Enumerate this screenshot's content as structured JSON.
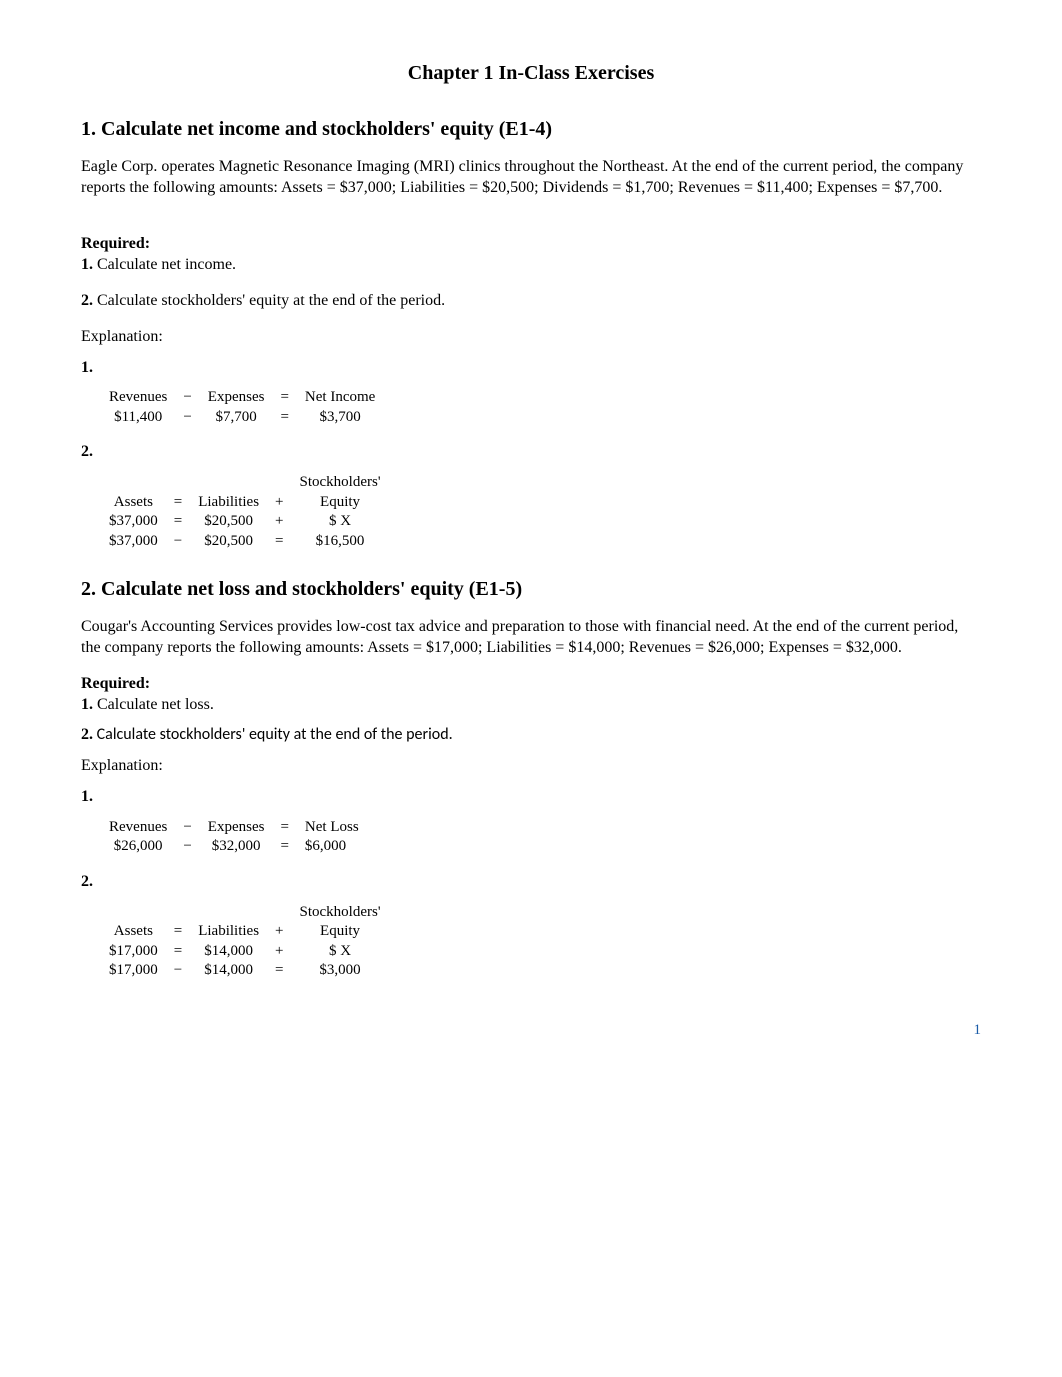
{
  "chapter_title": "Chapter 1 In-Class Exercises",
  "section1": {
    "title": "1. Calculate net income and stockholders' equity (E1-4)",
    "body": "Eagle Corp. operates Magnetic Resonance Imaging (MRI) clinics throughout the Northeast. At the end of the current period, the company reports the following amounts: Assets = $37,000; Liabilities = $20,500; Dividends = $1,700; Revenues = $11,400; Expenses = $7,700.",
    "required_label": "Required:",
    "req1_num": "1.",
    "req1_text": "  Calculate net income.",
    "req2_num": "2.",
    "req2_text": "  Calculate stockholders' equity at the end of the period.",
    "explanation_label": "Explanation:",
    "part1_num": "1.",
    "eq1": {
      "h1": "Revenues",
      "op1": "−",
      "h2": "Expenses",
      "op2": "=",
      "h3": "Net Income",
      "v1": "$11,400",
      "v2": "$7,700",
      "v3": "$3,700"
    },
    "part2_num": "2.",
    "eq2": {
      "h1": "Assets",
      "op1": "=",
      "h2": "Liabilities",
      "op2": "+",
      "h3a": "Stockholders'",
      "h3b": "Equity",
      "r1v1": "$37,000",
      "r1op1": "=",
      "r1v2": "$20,500",
      "r1op2": "+",
      "r1v3": "$     X",
      "r2v1": "$37,000",
      "r2op1": "−",
      "r2v2": "$20,500",
      "r2op2": "=",
      "r2v3": "$16,500"
    }
  },
  "section2": {
    "title": "2. Calculate net loss and stockholders' equity (E1-5)",
    "body": "Cougar's Accounting Services provides low-cost tax advice and preparation to those with financial need. At the end of the current period, the company reports the following amounts: Assets = $17,000; Liabilities = $14,000; Revenues = $26,000; Expenses = $32,000.",
    "required_label": "Required:",
    "req1_num": "1.",
    "req1_text": " Calculate net loss.",
    "req2_num": "2.",
    "req2_text": " Calculate stockholders' equity at the end of the period.",
    "explanation_label": "Explanation:",
    "part1_num": "1.",
    "eq1": {
      "h1": "Revenues",
      "op1": "−",
      "h2": "Expenses",
      "op2": "=",
      "h3": "Net Loss",
      "v1": "$26,000",
      "v2": "$32,000",
      "v3": "$6,000",
      "veq": "="
    },
    "part2_num": "2.",
    "eq2": {
      "h1": "Assets",
      "op1": "=",
      "h2": "Liabilities",
      "op2": "+",
      "h3a": "Stockholders'",
      "h3b": "Equity",
      "r1v1": "$17,000",
      "r1op1": "=",
      "r1v2": "$14,000",
      "r1op2": "+",
      "r1v3": "$     X",
      "r2v1": "$17,000",
      "r2op1": "−",
      "r2v2": "$14,000",
      "r2op2": "=",
      "r2v3": "$3,000"
    }
  },
  "page_number": "1"
}
